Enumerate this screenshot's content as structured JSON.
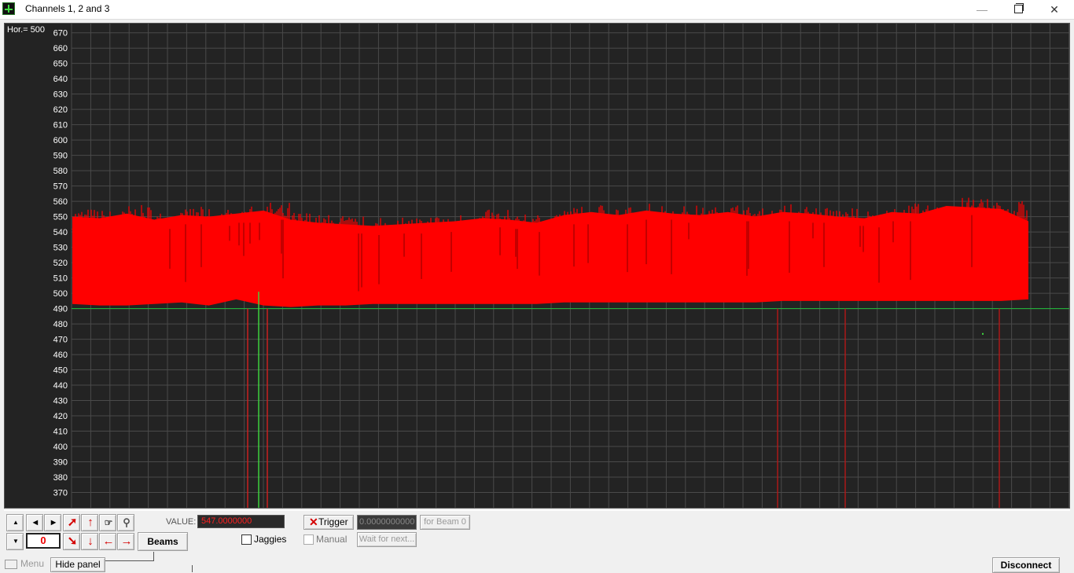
{
  "window": {
    "title": "Channels 1, 2 and 3",
    "minimize": "—",
    "close": "✕"
  },
  "plot": {
    "hor_label": "Hor.= 500",
    "background": "#232323",
    "grid_color": "#4a4a4a",
    "signal_color": "#ff0000",
    "baseline_color": "#1fbf3a"
  },
  "chart_data": {
    "type": "area",
    "y_ticks": [
      670,
      660,
      650,
      640,
      630,
      620,
      610,
      600,
      590,
      580,
      570,
      560,
      550,
      540,
      530,
      520,
      510,
      500,
      490,
      480,
      470,
      460,
      450,
      440,
      430,
      420,
      410,
      400,
      390,
      380,
      370
    ],
    "ylim": [
      360,
      676
    ],
    "baseline": 490,
    "series": [
      {
        "lower": [
          493,
          492,
          492,
          493,
          494,
          492,
          496,
          492,
          491,
          492,
          492,
          493,
          493,
          493,
          493,
          493,
          493,
          493,
          494,
          494,
          494,
          494,
          494,
          494,
          494,
          494,
          495,
          495,
          495,
          495,
          495,
          495,
          495,
          495,
          495,
          496
        ],
        "upper": [
          550,
          549,
          552,
          548,
          551,
          550,
          552,
          554,
          548,
          546,
          545,
          544,
          545,
          546,
          547,
          549,
          548,
          546,
          551,
          553,
          551,
          554,
          552,
          551,
          553,
          550,
          553,
          552,
          550,
          549,
          553,
          552,
          557,
          556,
          555,
          547
        ]
      }
    ]
  },
  "panel": {
    "value_label": "VALUE:",
    "value": "547.0000000",
    "counter": "0",
    "trigger_label": "Trigger",
    "trigger_value": "0.0000000000",
    "for_beam_label": "for Beam 0",
    "wait_label": "Wait for next...",
    "jaggies_label": "Jaggies",
    "manual_label": "Manual",
    "beams_label": "Beams"
  },
  "statusbar": {
    "menu_label": "Menu",
    "hide_panel_label": "Hide panel",
    "disconnect_label": "Disconnect"
  }
}
